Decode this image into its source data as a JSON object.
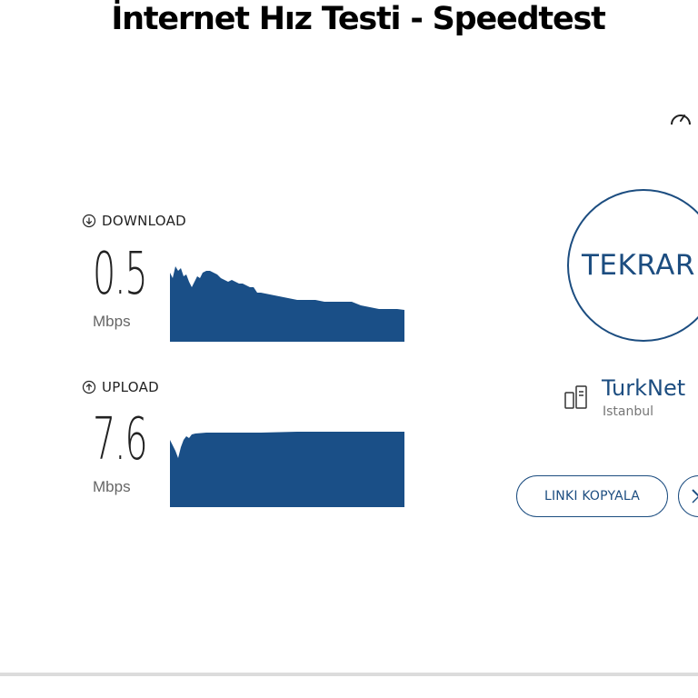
{
  "page": {
    "title": "İnternet Hız Testi - Speedtest"
  },
  "download": {
    "label": "DOWNLOAD",
    "value": "0.5",
    "unit": "Mbps",
    "icon": "arrow-down-circle-icon",
    "graph_color": "#1a4f87"
  },
  "upload": {
    "label": "UPLOAD",
    "value": "7.6",
    "unit": "Mbps",
    "icon": "arrow-up-circle-icon",
    "graph_color": "#1a4f87"
  },
  "controls": {
    "restart_label": "TEKRAR",
    "copy_link_label": "LINKI KOPYALA",
    "share_icon": "x-logo-icon",
    "settings_icon": "gauge-icon"
  },
  "server": {
    "isp": "TurkNet",
    "city": "Istanbul",
    "icon": "server-icon"
  },
  "colors": {
    "accent": "#1c4d80",
    "text": "#222222",
    "muted": "#666666"
  }
}
